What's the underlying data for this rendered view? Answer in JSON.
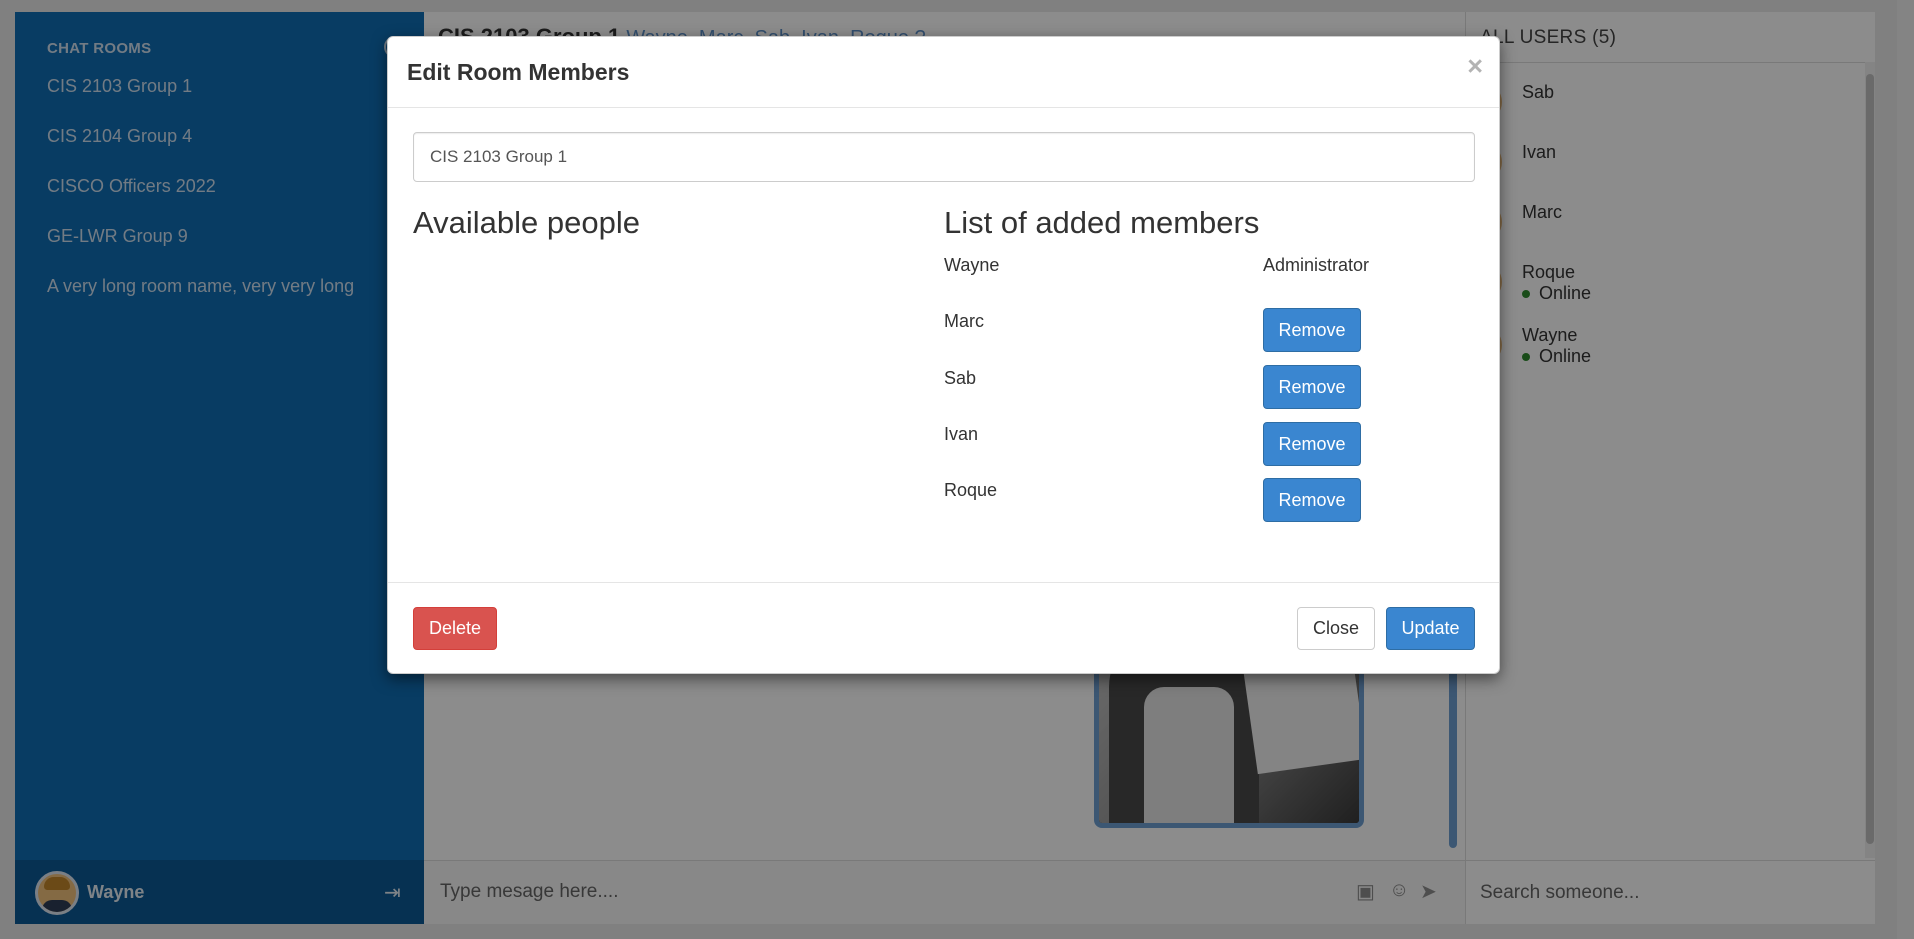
{
  "sidebar": {
    "title": "CHAT ROOMS",
    "rooms": [
      {
        "label": "CIS 2103 Group 1"
      },
      {
        "label": "CIS 2104 Group 4"
      },
      {
        "label": "CISCO Officers 2022"
      },
      {
        "label": "GE-LWR Group 9"
      },
      {
        "label": "A very long room name, very very long"
      }
    ],
    "current_user": "Wayne",
    "add_icon": "plus-circle-icon",
    "logout_icon": "logout-icon"
  },
  "chat": {
    "title": "CIS 2103 Group 1",
    "members_hint": "Wayne, Marc, Sab, Ivan, Roque ?",
    "input_placeholder": "Type mesage here...."
  },
  "users": {
    "title": "ALL USERS (5)",
    "list": [
      {
        "name": "Sab",
        "status": ""
      },
      {
        "name": "Ivan",
        "status": ""
      },
      {
        "name": "Marc",
        "status": ""
      },
      {
        "name": "Roque",
        "status": "Online"
      },
      {
        "name": "Wayne",
        "status": "Online"
      }
    ],
    "search_placeholder": "Search someone..."
  },
  "modal": {
    "title": "Edit Room Members",
    "close_symbol": "×",
    "room_name_value": "CIS 2103 Group 1",
    "available_title": "Available people",
    "added_title": "List of added members",
    "admin": {
      "name": "Wayne",
      "role": "Administrator"
    },
    "members": [
      {
        "name": "Marc",
        "action": "Remove"
      },
      {
        "name": "Sab",
        "action": "Remove"
      },
      {
        "name": "Ivan",
        "action": "Remove"
      },
      {
        "name": "Roque",
        "action": "Remove"
      }
    ],
    "delete_label": "Delete",
    "close_label": "Close",
    "update_label": "Update"
  },
  "colors": {
    "sidebar": "#0f6eb4",
    "primary_button": "#3a86d0",
    "danger_button": "#d9534f",
    "online_dot": "#2e8b2e"
  }
}
